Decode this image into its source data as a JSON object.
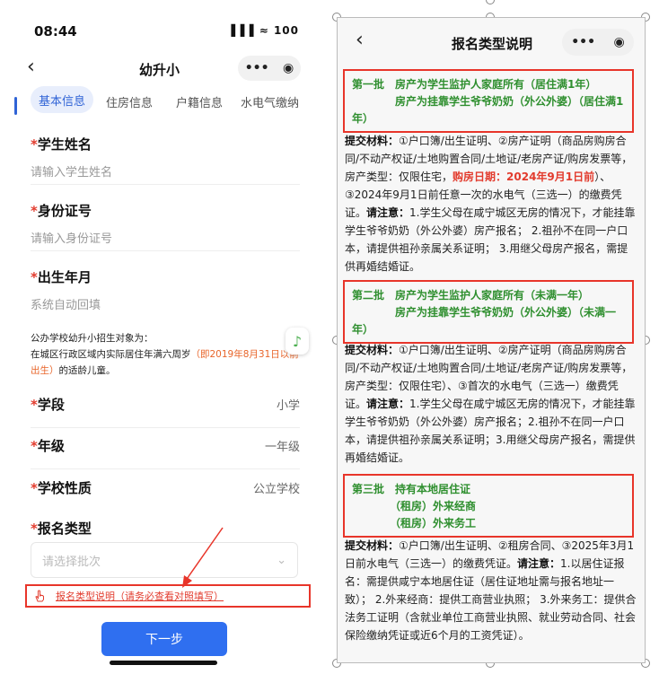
{
  "left": {
    "time": "08:44",
    "signal": "▐▐▐ ≈ 100",
    "back": "‹",
    "title": "幼升小",
    "more": "•••",
    "record": "◉",
    "tabs": [
      "基本信息",
      "住房信息",
      "户籍信息",
      "水电气缴纳"
    ],
    "name_label": "学生姓名",
    "name_ph": "请输入学生姓名",
    "id_label": "身份证号",
    "id_ph": "请输入身份证号",
    "birth_label": "出生年月",
    "birth_ph": "系统自动回填",
    "req": "*",
    "note_line1": "公办学校幼升小招生对象为：",
    "note_line2_a": "在城区行政区域内实际居住年满六周岁",
    "note_line2_hl": "（即2019年8月31日以前出生）",
    "note_line2_b": "的适龄儿童。",
    "stage_label": "学段",
    "stage_value": "小学",
    "grade_label": "年级",
    "grade_value": "一年级",
    "school_label": "学校性质",
    "school_value": "公立学校",
    "type_label": "报名类型",
    "type_ph": "请选择批次",
    "chevron": "⌄",
    "link_text": "报名类型说明（请务必查看对照填写）",
    "next": "下一步",
    "float_icon": "♪"
  },
  "right": {
    "back": "‹",
    "title": "报名类型说明",
    "more": "•••",
    "record": "◉",
    "b1_l1": "第一批　房产为学生监护人家庭所有（居住满1年）",
    "b1_l2": "　　　　房产为挂靠学生爷爷奶奶（外公外婆）（居住满1年）",
    "p1_a": "提交材料：",
    "p1_b": "①户口簿/出生证明、②房产证明（商品房购房合同/不动产权证/土地购置合同/土地证/老房产证/购房发票等，房产类型：仅限住宅，",
    "p1_red": "购房日期：2024年9月1日前",
    "p1_c": "）、③2024年9月1日前任意一次的水电气（三选一）的缴费凭证。",
    "p1_note": "请注意：",
    "p1_d": "1.学生父母在咸宁城区无房的情况下，才能挂靠学生爷爷奶奶（外公外婆）房产报名； 2.祖孙不在同一户口本，请提供祖孙亲属关系证明； 3.用继父母房产报名，需提供再婚结婚证。",
    "b2_l1": "第二批　房产为学生监护人家庭所有（未满一年）",
    "b2_l2": "　　　　房产为挂靠学生爷爷奶奶（外公外婆）（未满一年）",
    "p2_a": "提交材料：",
    "p2_b": "①户口簿/出生证明、②房产证明（商品房购房合同/不动产权证/土地购置合同/土地证/老房产证/购房发票等，房产类型：仅限住宅）、③首次的水电气（三选一）缴费凭证。",
    "p2_note": "请注意：",
    "p2_d": "1.学生父母在咸宁城区无房的情况下，才能挂靠学生爷爷奶奶（外公外婆）房产报名；2.祖孙不在同一户口本，请提供祖孙亲属关系证明；3.用继父母房产报名，需提供再婚结婚证。",
    "b3_l1": "第三批　持有本地居住证",
    "b3_l2": "　　　　（租房）外来经商",
    "b3_l3": "　　　　（租房）外来务工",
    "p3_a": "提交材料：",
    "p3_b": "①户口簿/出生证明、②租房合同、③2025年3月1日前水电气（三选一）的缴费凭证。",
    "p3_note": "请注意：",
    "p3_d": "1.以居住证报名：需提供咸宁本地居住证（居住证地址需与报名地址一致）； 2.外来经商：提供工商营业执照； 3.外来务工：提供合法务工证明（含就业单位工商营业执照、就业劳动合同、社会保险缴纳凭证或近6个月的工资凭证）。"
  }
}
